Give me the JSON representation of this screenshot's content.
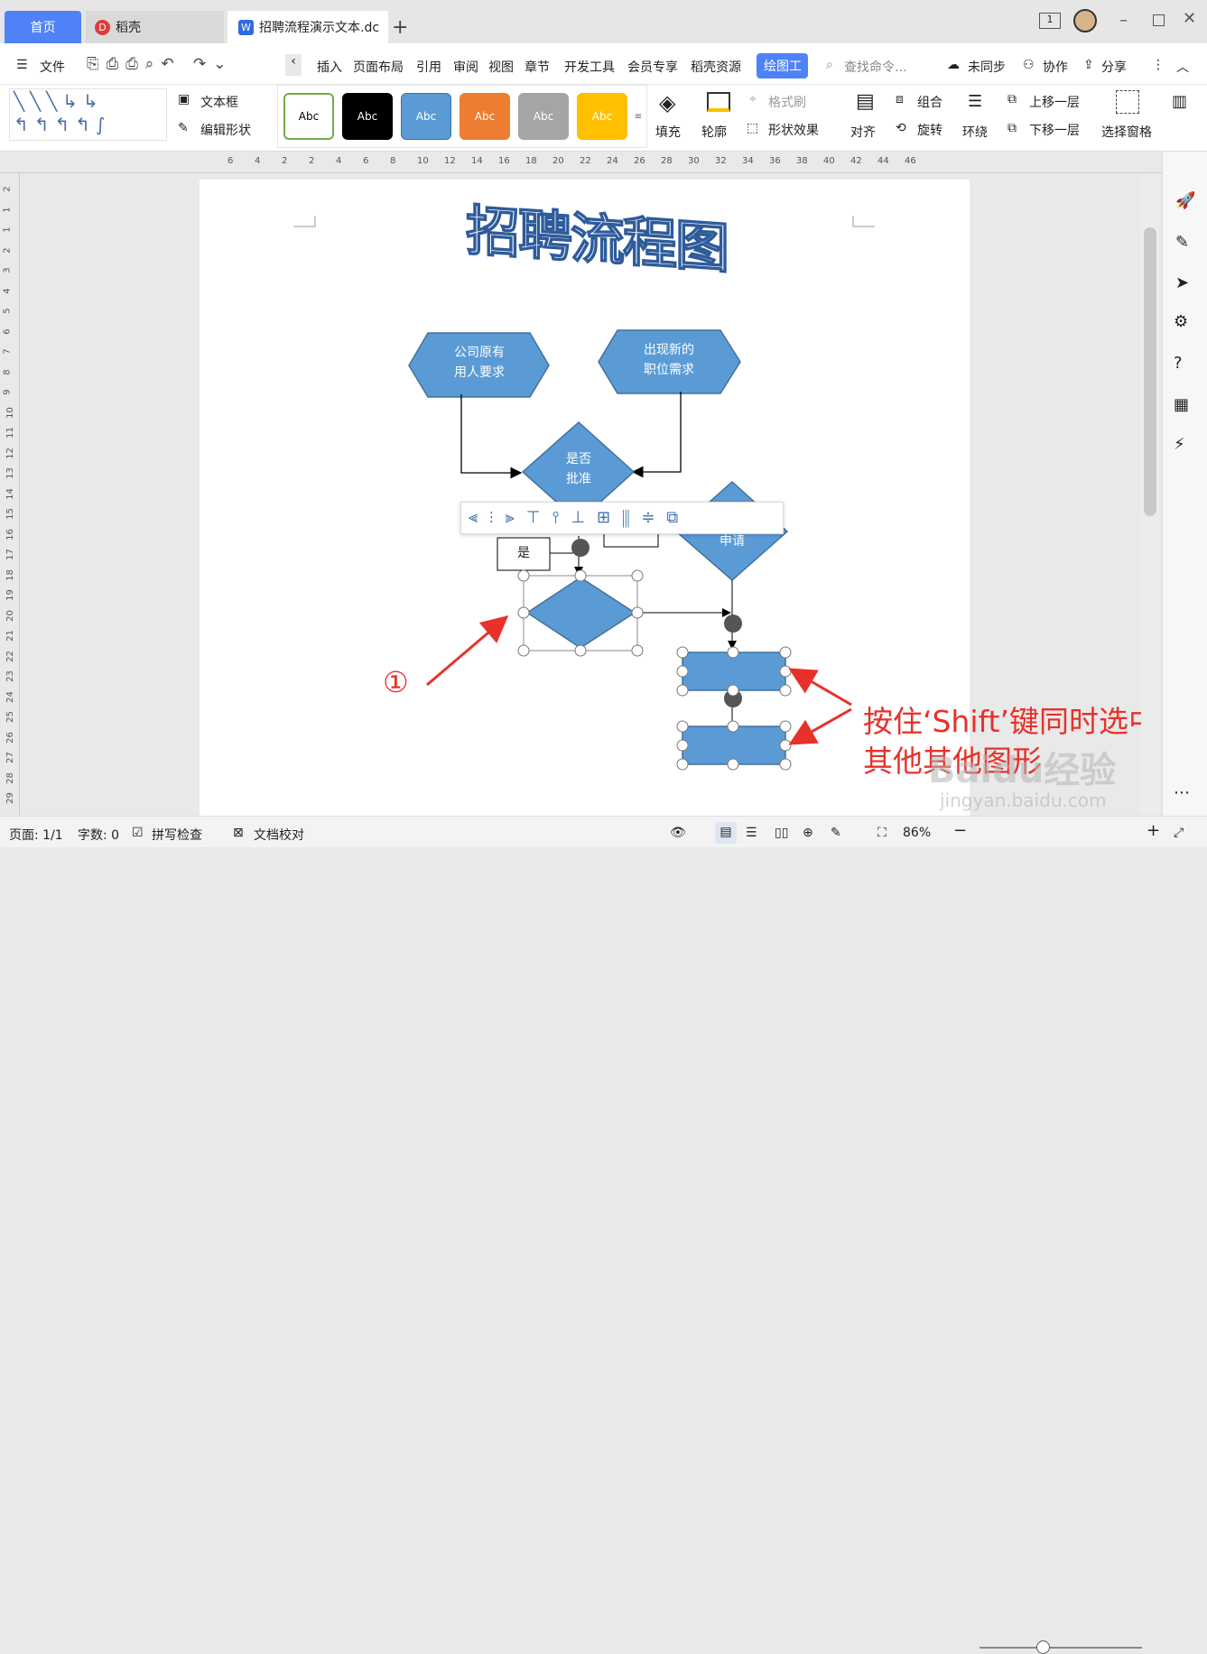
{
  "tabs": {
    "home": "首页",
    "daoke": "稻壳",
    "doc": "招聘流程演示文本.dc"
  },
  "menu": {
    "file": "文件",
    "items": [
      "插入",
      "页面布局",
      "引用",
      "审阅",
      "视图",
      "章节",
      "开发工具",
      "会员专享",
      "稻壳资源"
    ],
    "active": "绘图工",
    "search": "查找命令...",
    "sync": "未同步",
    "collab": "协作",
    "share": "分享"
  },
  "ribbon": {
    "textbox": "文本框",
    "edit_shape": "编辑形状",
    "styles": [
      "Abc",
      "Abc",
      "Abc",
      "Abc",
      "Abc",
      "Abc"
    ],
    "fill": "填充",
    "outline": "轮廓",
    "format_brush": "格式刷",
    "shape_effect": "形状效果",
    "align": "对齐",
    "group": "组合",
    "rotate": "旋转",
    "wrap": "环绕",
    "bring_forward": "上移一层",
    "send_backward": "下移一层",
    "selection_pane": "选择窗格"
  },
  "colors": {
    "accent": "#4f82f7",
    "shape_fill": "#5b9bd5",
    "shape_border": "#41719c",
    "annotation": "#e8312a"
  },
  "ruler_ticks": [
    "6",
    "4",
    "2",
    "2",
    "4",
    "6",
    "8",
    "10",
    "12",
    "14",
    "16",
    "18",
    "20",
    "22",
    "24",
    "26",
    "28",
    "30",
    "32",
    "34",
    "36",
    "38",
    "40",
    "42",
    "44",
    "46"
  ],
  "vruler_ticks": [
    "2",
    "1",
    "1",
    "2",
    "3",
    "4",
    "5",
    "6",
    "7",
    "8",
    "9",
    "10",
    "11",
    "12",
    "13",
    "14",
    "15",
    "16",
    "17",
    "18",
    "19",
    "20",
    "21",
    "22",
    "23",
    "24",
    "25",
    "26",
    "27",
    "28",
    "29"
  ],
  "doc": {
    "title_art": "招聘流程图",
    "shape1": "公司原有\n用人要求",
    "shape2": "出现新的\n职位需求",
    "decision": "是否\n批准",
    "apply": "申请",
    "yes": "是"
  },
  "annotations": {
    "circle1": "①",
    "instruction_line1": "按住‘Shift’键同时选中",
    "instruction_line2": "其他其他图形"
  },
  "watermark": {
    "brand": "Baidu经验",
    "url": "jingyan.baidu.com"
  },
  "status": {
    "page": "页面: 1/1",
    "words": "字数: 0",
    "spell": "拼写检查",
    "proof": "文档校对",
    "zoom": "86%"
  }
}
